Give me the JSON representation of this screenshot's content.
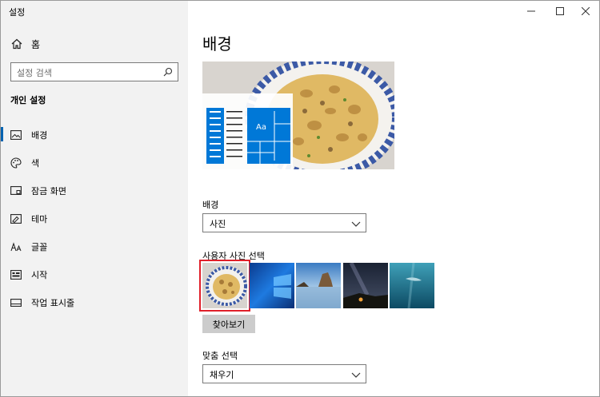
{
  "window": {
    "title": "설정",
    "controls": {
      "minimize": "minimize",
      "maximize": "maximize",
      "close": "close"
    }
  },
  "sidebar": {
    "home_label": "홈",
    "search_placeholder": "설정 검색",
    "section_title": "개인 설정",
    "items": [
      {
        "label": "배경",
        "icon": "picture-icon",
        "active": true
      },
      {
        "label": "색",
        "icon": "palette-icon",
        "active": false
      },
      {
        "label": "잠금 화면",
        "icon": "lock-screen-icon",
        "active": false
      },
      {
        "label": "테마",
        "icon": "theme-icon",
        "active": false
      },
      {
        "label": "글꼴",
        "icon": "font-icon",
        "active": false
      },
      {
        "label": "시작",
        "icon": "start-icon",
        "active": false
      },
      {
        "label": "작업 표시줄",
        "icon": "taskbar-icon",
        "active": false
      }
    ]
  },
  "main": {
    "title": "배경",
    "preview": {
      "tile_text": "Aa"
    },
    "background": {
      "label": "배경",
      "value": "사진"
    },
    "photo_select": {
      "label": "사용자 사진 선택",
      "thumbnails": [
        "pasta",
        "windows",
        "coast-rock",
        "night-sky",
        "underwater"
      ],
      "selected": 0
    },
    "browse_label": "찾아보기",
    "fit": {
      "label": "맞춤 선택",
      "value": "채우기"
    }
  },
  "colors": {
    "accent": "#0063b1",
    "selection_outline": "#e0202a",
    "sidebar_bg": "#f2f2f2",
    "button_bg": "#cccccc"
  }
}
